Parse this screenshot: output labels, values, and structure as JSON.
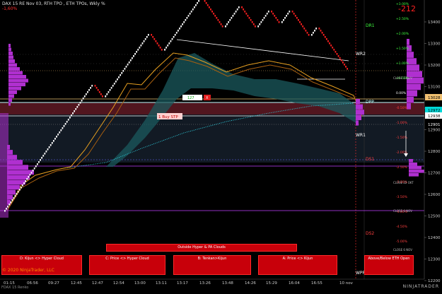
{
  "header": {
    "title": "DAX 15 RE Nov 03, RTH TPO , ETH TPOs, Wkly %",
    "sub": "-1,60%"
  },
  "pnl": "-212",
  "right_axis": [
    "13400",
    "13300",
    "13200",
    "13100",
    "13000",
    "12900",
    "12800",
    "12700",
    "12600",
    "12500",
    "12400",
    "12300",
    "12200"
  ],
  "price_boxes": [
    {
      "label": "13028",
      "bg": "#f0c070",
      "fg": "#000"
    },
    {
      "label": "12972",
      "bg": "#00d8d8",
      "fg": "#000"
    },
    {
      "label": "12938",
      "bg": "#ffffff",
      "fg": "#000"
    },
    {
      "label": "12901",
      "bg": "#000000",
      "fg": "#ffffff"
    }
  ],
  "level_labels": {
    "dr1": "DR1",
    "wr2": "WR2",
    "dpp": "DPP",
    "wr1": "WR1",
    "ds1": "DS1",
    "ds2": "DS2",
    "wpp": "WPP",
    "buy_stp": "1 Buy STP",
    "order_qty": "127",
    "order_x": "X"
  },
  "pct_labels": [
    "+3.00%",
    "+2.50%",
    "+2.00%",
    "+1.50%",
    "+1.00%",
    "+0.50%",
    "0.00%",
    "-0.50%",
    "-1.00%",
    "-1.50%",
    "-2.00%",
    "-2.50%",
    "-3.00%",
    "-3.50%",
    "-4.00%",
    "-4.50%",
    "-5.00%"
  ],
  "small_labels": [
    "CLOSE 13ocV",
    "CLOSE 22 OKT",
    "CLOSE 6 NOV",
    "CLOSE 6 NOV"
  ],
  "buttons": {
    "top": "Outside Hyper & PA Clouds",
    "b1": "D: Kijun <> Hyper Cloud",
    "b2": "C: Price <> Hyper Cloud",
    "b3": "B: Tenkan>Kijun",
    "b4": "A: Price <> Kijun",
    "b5": "Above/Below ETH Open"
  },
  "time_axis": [
    "01:15",
    "06:56",
    "09:27",
    "12:45",
    "12:47",
    "12:54",
    "13:00",
    "13:11",
    "13:17",
    "13:26",
    "13:48",
    "14:26",
    "15:29",
    "16:04",
    "16:55",
    "10 nov"
  ],
  "copyright": "© 2020 NinjaTrader, LLC",
  "footer": "FDAX 15 Renko",
  "logo": "NINJATRADER",
  "colors": {
    "bull": "#ffffff",
    "bear": "#ff2020",
    "cloud": "#1b5a5e",
    "tenkan": "#e8a020",
    "profile": "#b030d0",
    "dpp": "#c0ffff"
  }
}
